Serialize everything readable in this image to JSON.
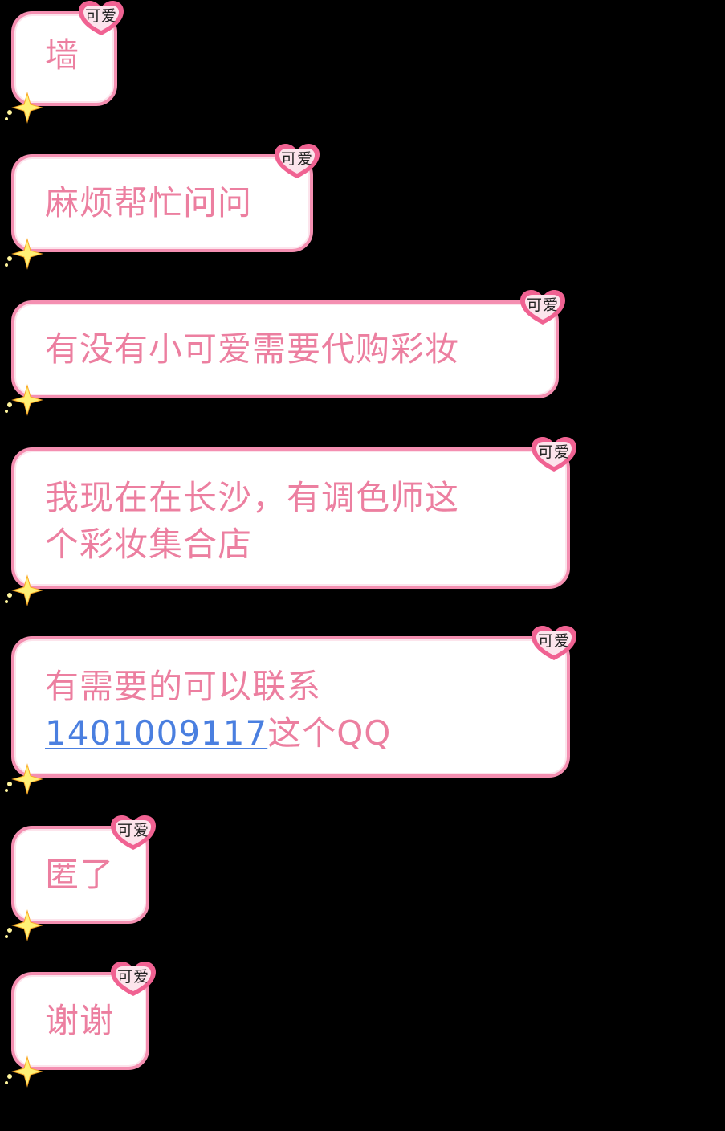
{
  "colors": {
    "background": "#000000",
    "bubble_fill": "#ffffff",
    "bubble_border": "#f48fb1",
    "text": "#ec7fa0",
    "link": "#4a7fe0",
    "badge": "#f06292",
    "sparkle": "#fff176"
  },
  "badge_label": "可爱",
  "messages": [
    {
      "lines": [
        "墙"
      ]
    },
    {
      "lines": [
        "麻烦帮忙问问"
      ]
    },
    {
      "lines": [
        "有没有小可爱需要代购彩妆"
      ]
    },
    {
      "lines": [
        "我现在在长沙，有调色师这",
        "个彩妆集合店"
      ]
    },
    {
      "line1": "有需要的可以联系",
      "link": "1401009117",
      "after_link": "这个QQ"
    },
    {
      "lines": [
        "匿了"
      ]
    },
    {
      "lines": [
        "谢谢"
      ]
    }
  ]
}
